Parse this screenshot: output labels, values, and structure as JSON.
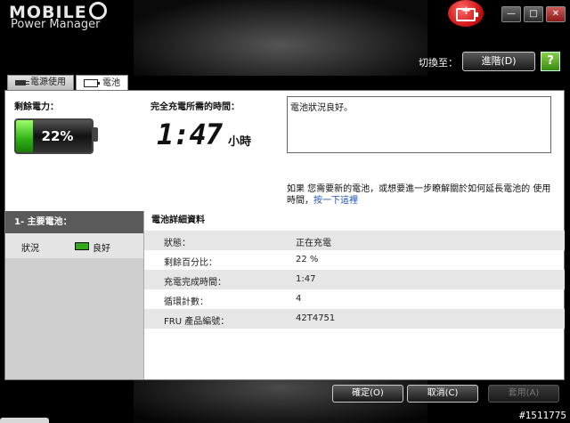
{
  "app": {
    "logo": "MOBILE",
    "title": "Power Manager"
  },
  "header": {
    "switch_label": "切換至：",
    "advanced_button": "進階(D)",
    "help_icon": "?"
  },
  "tabs": [
    {
      "label": "電源使用",
      "icon": "plug-icon"
    },
    {
      "label": "電池",
      "icon": "battery-icon"
    }
  ],
  "battery": {
    "remaining_label": "剩餘電力：",
    "percent_text": "22%",
    "percent_value": 22,
    "charge_time_label": "完全充電所需的時間：",
    "time_value": "1:47",
    "time_unit": "小時",
    "status_message": "電池狀況良好。",
    "hint_text": "如果 您需要新的電池，或想要進一步瞭解關於如何延長電池的 使用時間，",
    "hint_link": "按一下這裡"
  },
  "left_pane": {
    "header": "1- 主要電池：",
    "status_label": "狀況",
    "status_value": "良好"
  },
  "details": {
    "header": "電池詳細資料",
    "rows": [
      {
        "key": "狀態：",
        "value": "正在充電"
      },
      {
        "key": "剩餘百分比：",
        "value": "22 %"
      },
      {
        "key": "充電完成時間：",
        "value": "1:47"
      },
      {
        "key": "循環計數：",
        "value": "4"
      },
      {
        "key": "FRU 產品編號：",
        "value": "42T4751"
      }
    ]
  },
  "footer": {
    "ok": "確定(O)",
    "cancel": "取消(C)",
    "apply": "套用(A)"
  },
  "watermark": "#1511775",
  "colors": {
    "battery_fill": "#2fb015",
    "badge_red": "#d01818",
    "link": "#2050b0"
  }
}
